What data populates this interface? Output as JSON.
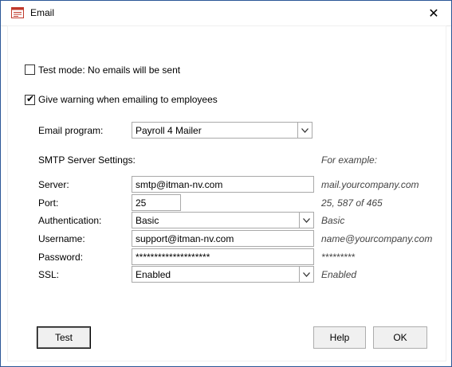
{
  "window": {
    "title": "Email",
    "close_symbol": "✕"
  },
  "options": {
    "test_mode": {
      "label": "Test mode: No emails will be sent",
      "checked": false
    },
    "give_warning": {
      "label": "Give warning when emailing to employees",
      "checked": true
    }
  },
  "email_program": {
    "label": "Email program:",
    "value": "Payroll 4 Mailer"
  },
  "smtp": {
    "section_label": "SMTP Server Settings:",
    "example_header": "For example:",
    "fields": {
      "server": {
        "label": "Server:",
        "value": "smtp@itman-nv.com",
        "example": "mail.yourcompany.com"
      },
      "port": {
        "label": "Port:",
        "value": "25",
        "example": "25, 587 of 465"
      },
      "authentication": {
        "label": "Authentication:",
        "value": "Basic",
        "example": "Basic"
      },
      "username": {
        "label": "Username:",
        "value": "support@itman-nv.com",
        "example": "name@yourcompany.com"
      },
      "password": {
        "label": "Password:",
        "value": "********************",
        "example": "*********"
      },
      "ssl": {
        "label": "SSL:",
        "value": "Enabled",
        "example": "Enabled"
      }
    }
  },
  "buttons": {
    "test": "Test",
    "help": "Help",
    "ok": "OK"
  },
  "icons": {
    "title": "form-icon",
    "close": "close-icon",
    "dropdown": "chevron-down-icon",
    "check": "checkmark-icon"
  }
}
